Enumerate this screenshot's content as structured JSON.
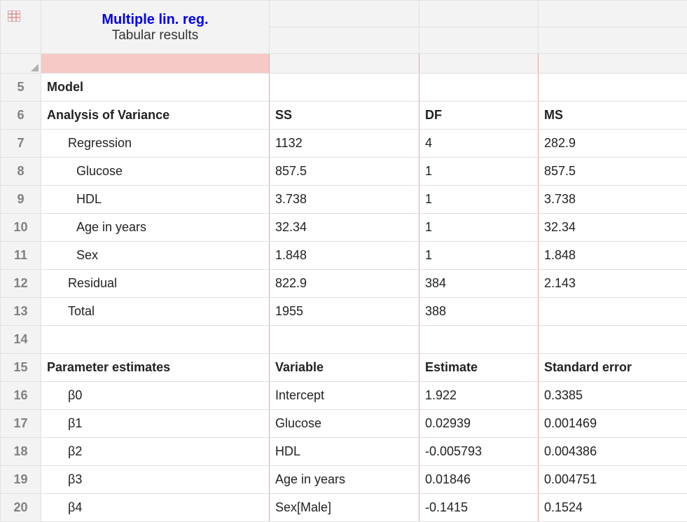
{
  "header": {
    "title": "Multiple lin. reg.",
    "subtitle": "Tabular results",
    "icon": "grid-table-icon"
  },
  "rows": [
    {
      "num": "5",
      "a": {
        "text": "Model",
        "bold": true,
        "indent": 0
      },
      "b": "",
      "c": "",
      "d": ""
    },
    {
      "num": "6",
      "a": {
        "text": "Analysis of Variance",
        "bold": true,
        "indent": 0
      },
      "b_bold": true,
      "b": "SS",
      "c_bold": true,
      "c": "DF",
      "d_bold": true,
      "d": "MS"
    },
    {
      "num": "7",
      "a": {
        "text": "Regression",
        "bold": false,
        "indent": 1
      },
      "b": "1132",
      "c": "4",
      "d": "282.9"
    },
    {
      "num": "8",
      "a": {
        "text": "Glucose",
        "bold": false,
        "indent": 2
      },
      "b": "857.5",
      "c": "1",
      "d": "857.5"
    },
    {
      "num": "9",
      "a": {
        "text": "HDL",
        "bold": false,
        "indent": 2
      },
      "b": "3.738",
      "c": "1",
      "d": "3.738"
    },
    {
      "num": "10",
      "a": {
        "text": "Age in years",
        "bold": false,
        "indent": 2
      },
      "b": "32.34",
      "c": "1",
      "d": "32.34"
    },
    {
      "num": "11",
      "a": {
        "text": "Sex",
        "bold": false,
        "indent": 2
      },
      "b": "1.848",
      "c": "1",
      "d": "1.848"
    },
    {
      "num": "12",
      "a": {
        "text": "Residual",
        "bold": false,
        "indent": 1
      },
      "b": "822.9",
      "c": "384",
      "d": "2.143"
    },
    {
      "num": "13",
      "a": {
        "text": "Total",
        "bold": false,
        "indent": 1
      },
      "b": "1955",
      "c": "388",
      "d": ""
    },
    {
      "num": "14",
      "a": {
        "text": "",
        "bold": false,
        "indent": 0
      },
      "b": "",
      "c": "",
      "d": ""
    },
    {
      "num": "15",
      "a": {
        "text": "Parameter estimates",
        "bold": true,
        "indent": 0
      },
      "b_bold": true,
      "b": "Variable",
      "c_bold": true,
      "c": "Estimate",
      "d_bold": true,
      "d": "Standard error"
    },
    {
      "num": "16",
      "a": {
        "text": "β0",
        "bold": false,
        "indent": 1
      },
      "b": "Intercept",
      "c": "1.922",
      "d": "0.3385"
    },
    {
      "num": "17",
      "a": {
        "text": "β1",
        "bold": false,
        "indent": 1
      },
      "b": "Glucose",
      "c": "0.02939",
      "d": "0.001469"
    },
    {
      "num": "18",
      "a": {
        "text": "β2",
        "bold": false,
        "indent": 1
      },
      "b": "HDL",
      "c": "-0.005793",
      "d": "0.004386"
    },
    {
      "num": "19",
      "a": {
        "text": "β3",
        "bold": false,
        "indent": 1
      },
      "b": "Age in years",
      "c": "0.01846",
      "d": "0.004751"
    },
    {
      "num": "20",
      "a": {
        "text": "β4",
        "bold": false,
        "indent": 1
      },
      "b": "Sex[Male]",
      "c": "-0.1415",
      "d": "0.1524"
    }
  ]
}
